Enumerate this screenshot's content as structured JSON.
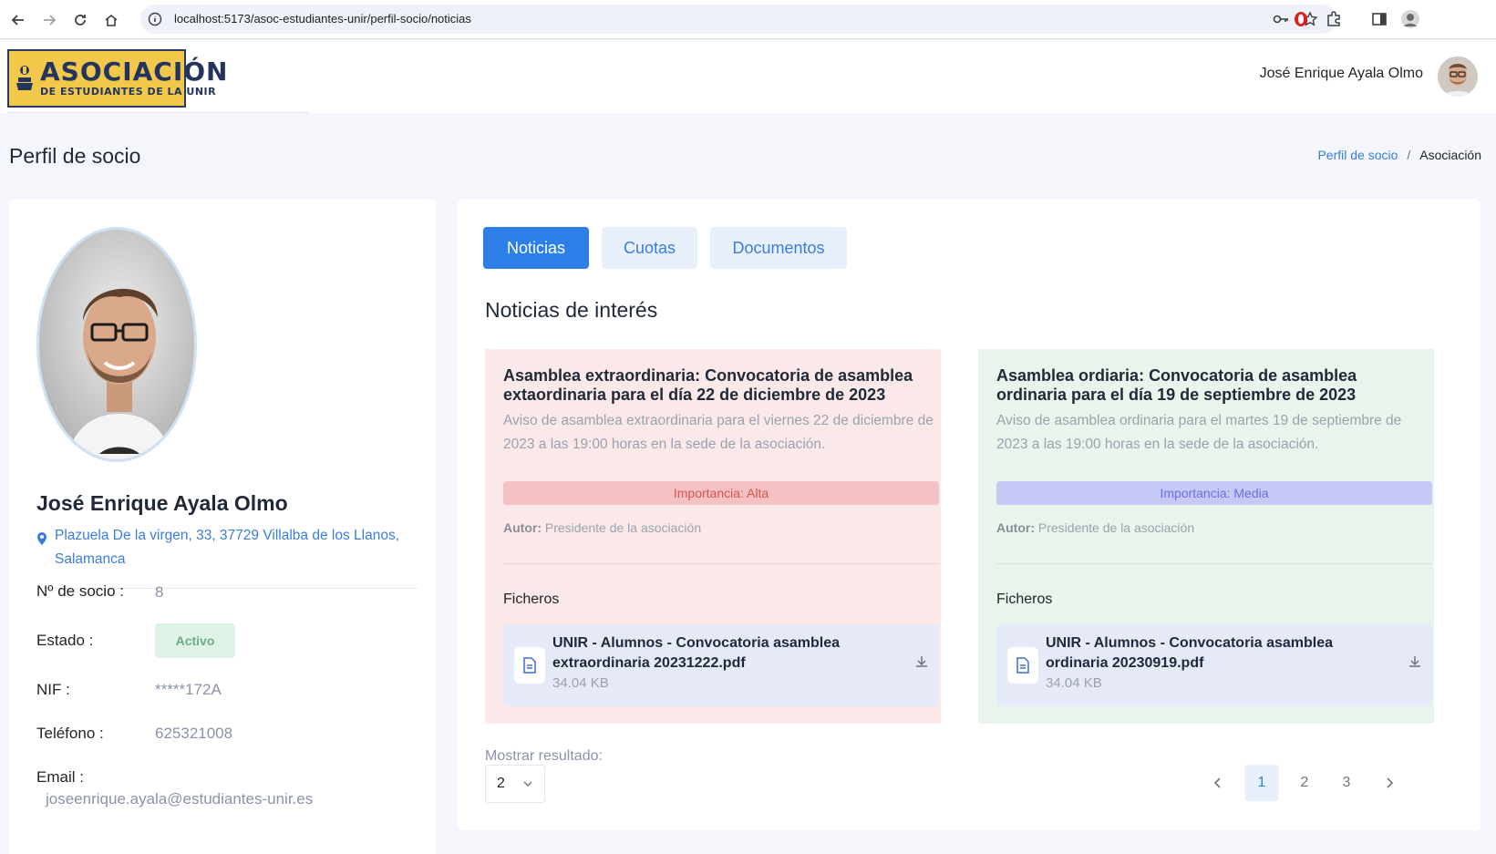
{
  "browser": {
    "url": "localhost:5173/asoc-estudiantes-unir/perfil-socio/noticias"
  },
  "header": {
    "logo_title": "ASOCIACIÓN",
    "logo_subtitle": "DE ESTUDIANTES DE LA UNIR",
    "user_name": "José Enrique Ayala Olmo"
  },
  "page": {
    "title": "Perfil de socio",
    "breadcrumb": {
      "link": "Perfil de socio",
      "separator": "/",
      "current": "Asociación"
    }
  },
  "profile": {
    "name": "José Enrique Ayala Olmo",
    "address": "Plazuela De la virgen, 33, 37729 Villalba de los Llanos, Salamanca",
    "fields": {
      "socio_label": "Nº de socio :",
      "socio_value": "8",
      "estado_label": "Estado :",
      "estado_value": "Activo",
      "nif_label": "NIF :",
      "nif_value": "*****172A",
      "telefono_label": "Teléfono :",
      "telefono_value": "625321008",
      "email_label": "Email :",
      "email_value": "joseenrique.ayala@estudiantes-unir.es"
    }
  },
  "tabs": [
    {
      "label": "Noticias",
      "active": true
    },
    {
      "label": "Cuotas",
      "active": false
    },
    {
      "label": "Documentos",
      "active": false
    }
  ],
  "news_section": {
    "title": "Noticias de interés",
    "items": [
      {
        "title": "Asamblea extraordinaria: Convocatoria de asamblea extaordinaria para el día 22 de diciembre de 2023",
        "description": "Aviso de asamblea extraordinaria para el viernes 22 de diciembre de 2023 a las 19:00 horas en la sede de la asociación.",
        "importance": "Importancia: Alta",
        "author_label": "Autor:",
        "author": "Presidente de la asociación",
        "files_label": "Ficheros",
        "file_name": "UNIR - Alumnos - Convocatoria asamblea extraordinaria 20231222.pdf",
        "file_size": "34.04 KB",
        "color": "#fbe9e9"
      },
      {
        "title": "Asamblea ordiaria: Convocatoria de asamblea ordinaria para el día 19 de septiembre de 2023",
        "description": "Aviso de asamblea ordinaria para el martes 19 de septiembre de 2023 a las 19:00 horas en la sede de la asociación.",
        "importance": "Importancia: Media",
        "author_label": "Autor:",
        "author": "Presidente de la asociación",
        "files_label": "Ficheros",
        "file_name": "UNIR - Alumnos - Convocatoria asamblea ordinaria 20230919.pdf",
        "file_size": "34.04 KB",
        "color": "#e9f4ec"
      }
    ]
  },
  "pagination": {
    "show_label": "Mostrar resultado:",
    "page_size": "2",
    "pages": [
      "1",
      "2",
      "3"
    ],
    "current": "1"
  },
  "colors": {
    "primary": "#2d7fe8",
    "high_importance": "#d9534f",
    "mid_importance": "#6a6fe0",
    "active_badge": "#6fab86"
  }
}
